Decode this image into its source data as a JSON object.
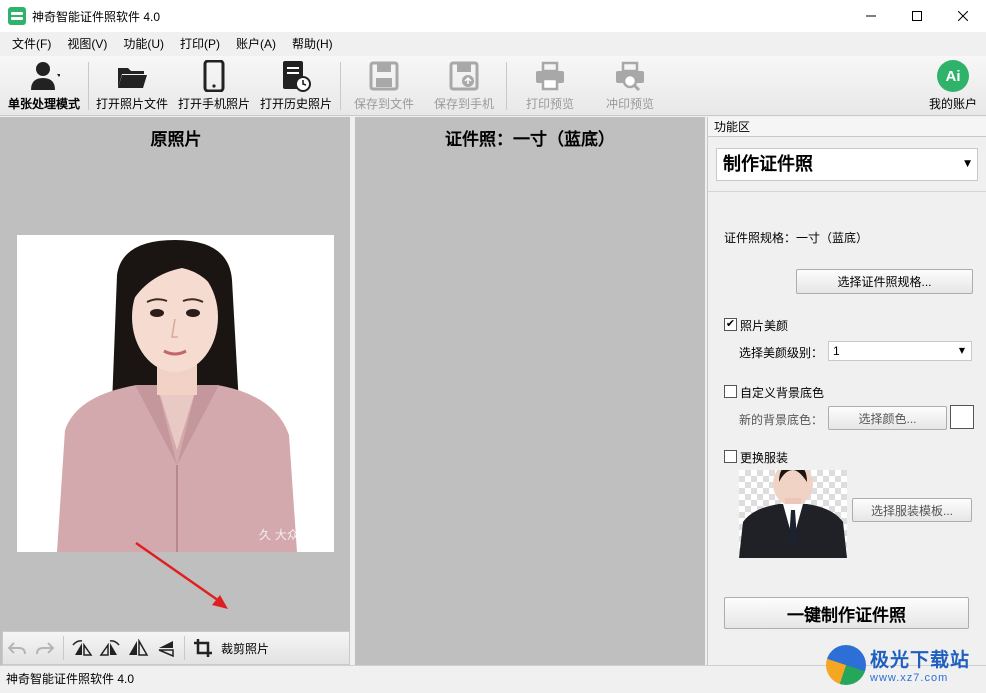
{
  "window": {
    "title": "神奇智能证件照软件 4.0",
    "controls": {
      "minimize": "—",
      "maximize": "☐",
      "close": "✕"
    }
  },
  "menu": [
    "文件(F)",
    "视图(V)",
    "功能(U)",
    "打印(P)",
    "账户(A)",
    "帮助(H)"
  ],
  "toolbar": {
    "single_mode": "单张处理模式",
    "open_photo_file": "打开照片文件",
    "open_phone_photo": "打开手机照片",
    "open_history_photo": "打开历史照片",
    "save_to_file": "保存到文件",
    "save_to_phone": "保存到手机",
    "print_preview": "打印预览",
    "develop_preview": "冲印预览",
    "account_badge": "Ai",
    "my_account": "我的账户"
  },
  "original_panel": {
    "title": "原照片",
    "photo_watermark": "久 大众",
    "crop_label": "裁剪照片"
  },
  "result_panel": {
    "title": "证件照：一寸（蓝底）"
  },
  "function_panel": {
    "header": "功能区",
    "mode": "制作证件照",
    "spec_label": "证件照规格：一寸（蓝底）",
    "choose_spec_button": "选择证件照规格...",
    "beauty_checkbox": "照片美颜",
    "beauty_checked": "✔",
    "beauty_level_label": "选择美颜级别：",
    "beauty_level_value": "1",
    "custom_bg_checkbox": "自定义背景底色",
    "new_bg_label": "新的背景底色：",
    "choose_color_button": "选择颜色...",
    "change_outfit_checkbox": "更换服装",
    "choose_outfit_button": "选择服装模板...",
    "make_button": "一键制作证件照",
    "swatch_color": "#ffffff"
  },
  "statusbar": {
    "text": "神奇智能证件照软件 4.0"
  },
  "watermark": {
    "name": "极光下载站",
    "url": "www.xz7.com"
  }
}
